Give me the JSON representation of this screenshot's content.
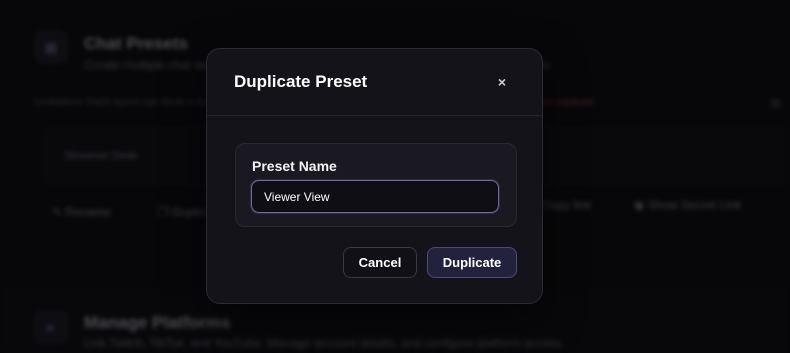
{
  "background": {
    "section1": {
      "title": "Chat Presets",
      "description": "Create multiple chat windows and customize each individual chat window with their own"
    },
    "note": {
      "text": "Limitations: Each layout can show a subset of the platforms and each layout is saved per browser tab.",
      "warning": "Note: Tabs are separate"
    },
    "preset_card": {
      "label": "Streamer Desk"
    },
    "toolbar": {
      "rename": "Rename",
      "duplicate": "Duplicate",
      "copy_url": "Copy link",
      "show_secret": "Show Secret Link"
    },
    "section2": {
      "title": "Manage Platforms",
      "description": "Link Twitch, TikTok, and YouTube. Manage account details, and configure platform access."
    }
  },
  "modal": {
    "title": "Duplicate Preset",
    "close_symbol": "×",
    "field_label": "Preset Name",
    "field_value": "Viewer View",
    "cancel_label": "Cancel",
    "confirm_label": "Duplicate"
  },
  "colors": {
    "accent_border": "#6e6aa3",
    "confirm_bg": "#23223c",
    "warning": "#d05a5a"
  }
}
